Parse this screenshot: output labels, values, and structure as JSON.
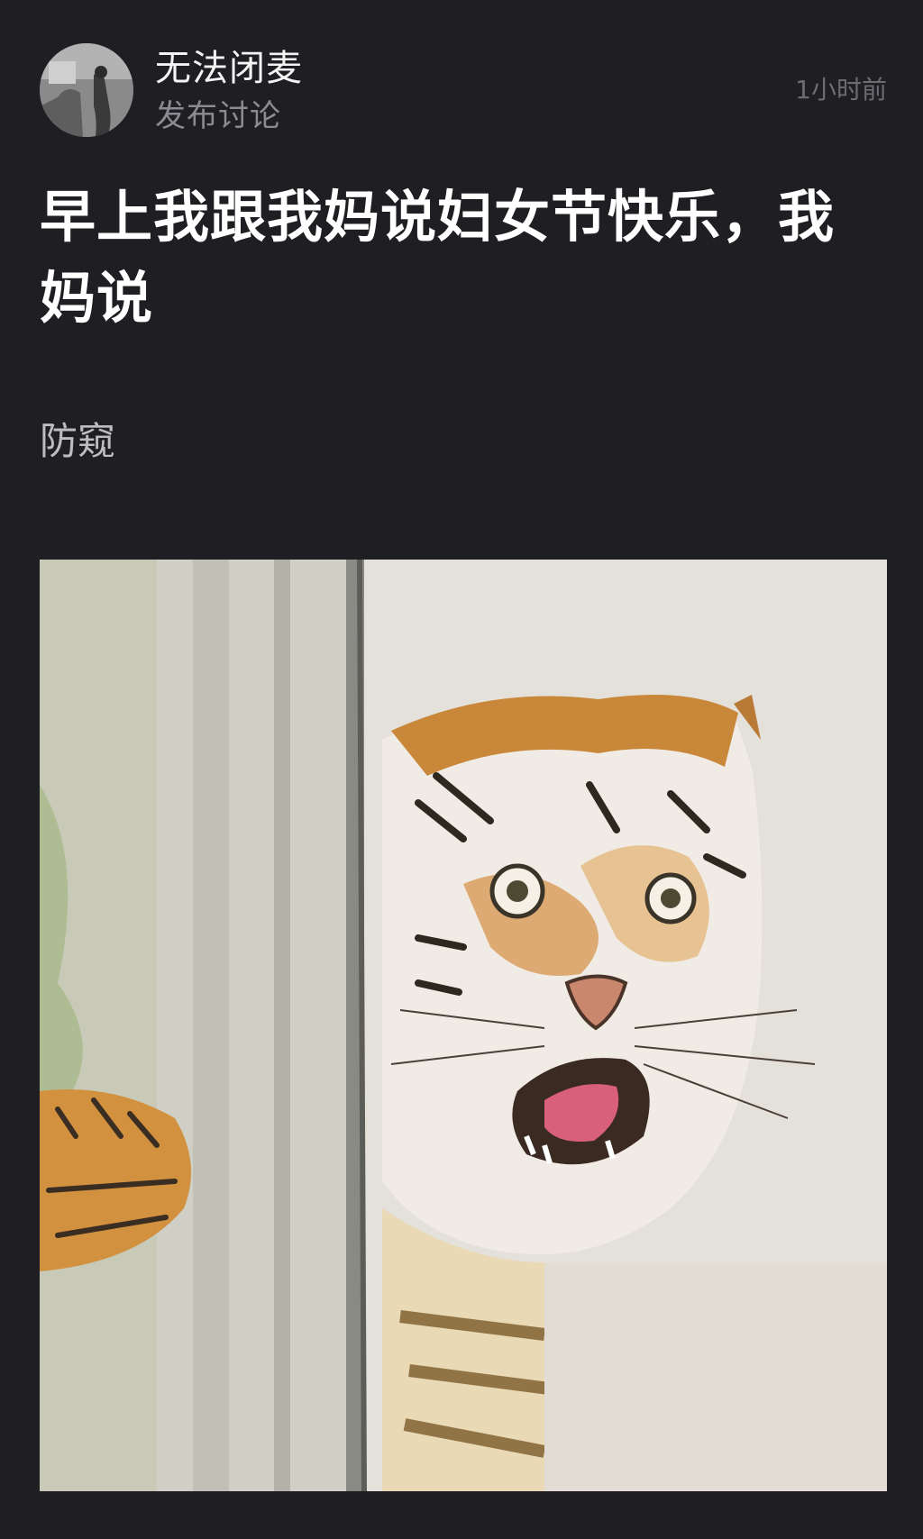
{
  "post": {
    "author": {
      "name": "无法闭麦",
      "action": "发布讨论"
    },
    "timestamp": "1小时前",
    "title": "早上我跟我妈说妇女节快乐，我妈说",
    "body": "防窥",
    "image": {
      "icon": "tiger-meme-image"
    }
  }
}
